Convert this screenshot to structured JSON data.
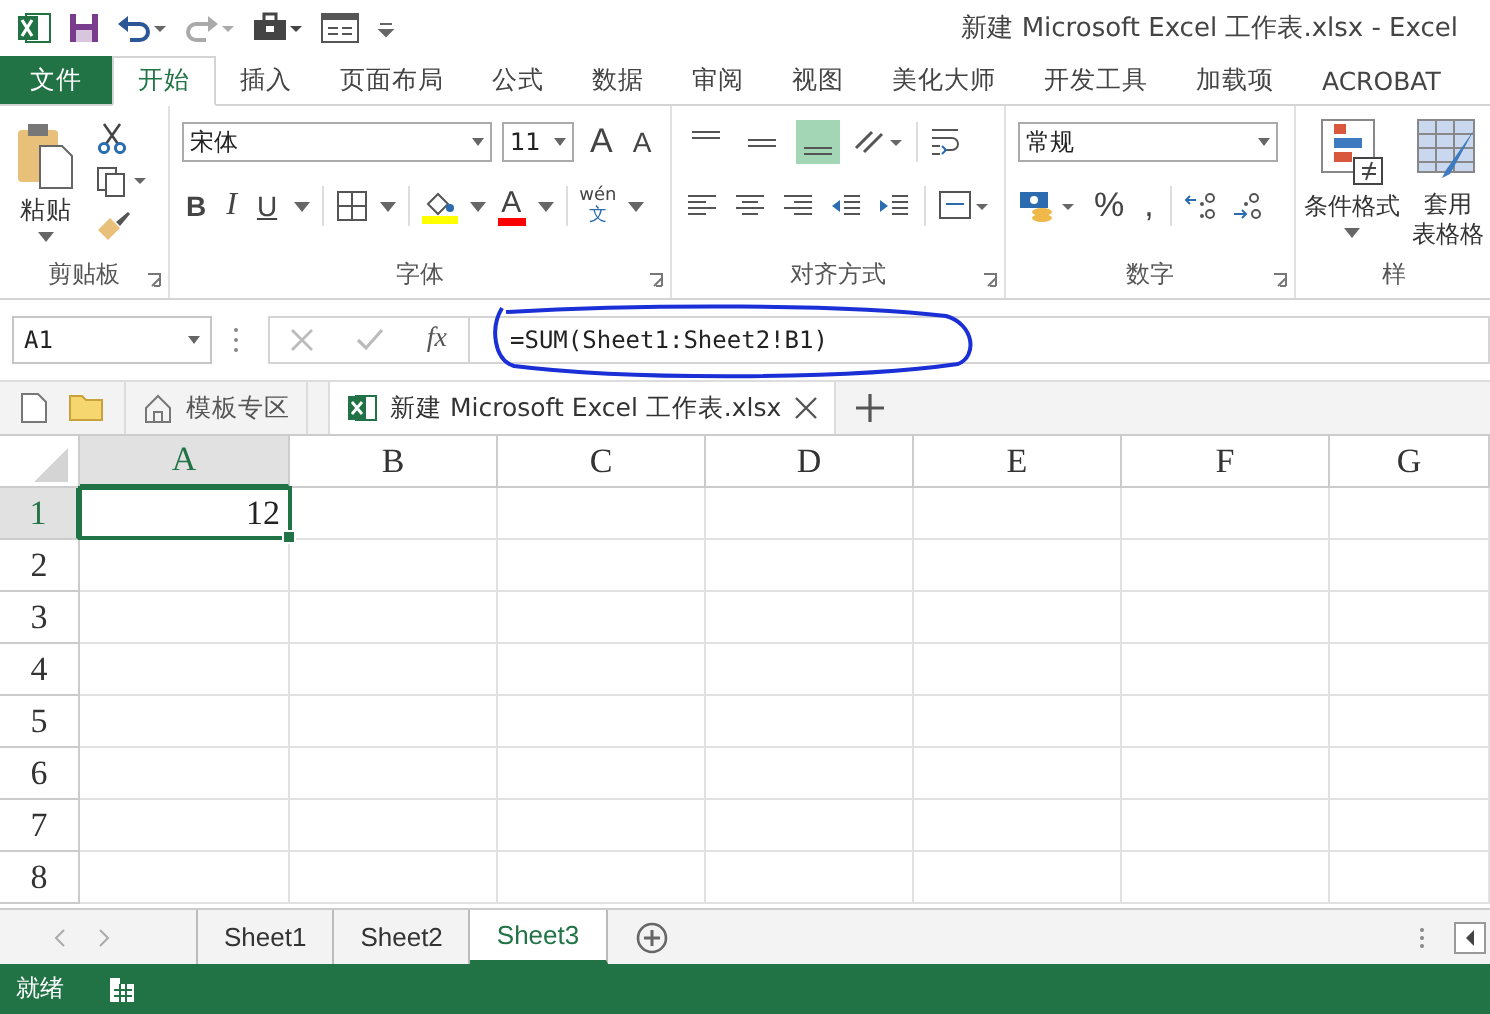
{
  "window": {
    "title": "新建 Microsoft Excel 工作表.xlsx - Excel"
  },
  "ribbon_tabs": [
    {
      "label": "文件",
      "kind": "file",
      "selected": false
    },
    {
      "label": "开始",
      "kind": "tab",
      "selected": true
    },
    {
      "label": "插入",
      "kind": "tab",
      "selected": false
    },
    {
      "label": "页面布局",
      "kind": "tab",
      "selected": false
    },
    {
      "label": "公式",
      "kind": "tab",
      "selected": false
    },
    {
      "label": "数据",
      "kind": "tab",
      "selected": false
    },
    {
      "label": "审阅",
      "kind": "tab",
      "selected": false
    },
    {
      "label": "视图",
      "kind": "tab",
      "selected": false
    },
    {
      "label": "美化大师",
      "kind": "tab",
      "selected": false
    },
    {
      "label": "开发工具",
      "kind": "tab",
      "selected": false
    },
    {
      "label": "加载项",
      "kind": "tab",
      "selected": false
    },
    {
      "label": "ACROBAT",
      "kind": "tab",
      "selected": false
    }
  ],
  "ribbon": {
    "clipboard": {
      "paste": "粘贴",
      "label": "剪贴板"
    },
    "font": {
      "name": "宋体",
      "size": "11",
      "grow": "A",
      "shrink": "A",
      "bold": "B",
      "italic": "I",
      "underline": "U",
      "font_color": "A",
      "phonetic_top": "wén",
      "phonetic_bottom": "文",
      "label": "字体"
    },
    "alignment": {
      "label": "对齐方式"
    },
    "number": {
      "format": "常规",
      "percent": "%",
      "comma": ",",
      "label": "数字"
    },
    "styles": {
      "conditional": "条件格式",
      "table_format_top": "套用",
      "table_format_bottom": "表格格",
      "label": "样"
    }
  },
  "formula_bar": {
    "name_box": "A1",
    "fx": "fx",
    "formula": "=SUM(Sheet1:Sheet2!B1)"
  },
  "doc_tabs": [
    {
      "label": "模板专区",
      "selected": false
    },
    {
      "label": "新建 Microsoft Excel 工作表.xlsx",
      "selected": true
    }
  ],
  "sheet": {
    "columns": [
      {
        "label": "A",
        "selected": true
      },
      {
        "label": "B",
        "selected": false
      },
      {
        "label": "C",
        "selected": false
      },
      {
        "label": "D",
        "selected": false
      },
      {
        "label": "E",
        "selected": false
      },
      {
        "label": "F",
        "selected": false
      },
      {
        "label": "G",
        "selected": false
      }
    ],
    "rows": [
      {
        "label": "1",
        "selected": true,
        "cells": [
          {
            "value": "12",
            "selected": true
          }
        ]
      },
      {
        "label": "2",
        "selected": false
      },
      {
        "label": "3",
        "selected": false
      },
      {
        "label": "4",
        "selected": false
      },
      {
        "label": "5",
        "selected": false
      },
      {
        "label": "6",
        "selected": false
      },
      {
        "label": "7",
        "selected": false
      },
      {
        "label": "8",
        "selected": false
      }
    ]
  },
  "sheet_tabs": [
    {
      "label": "Sheet1",
      "selected": false
    },
    {
      "label": "Sheet2",
      "selected": false
    },
    {
      "label": "Sheet3",
      "selected": true
    }
  ],
  "status_bar": {
    "text": "就绪"
  }
}
